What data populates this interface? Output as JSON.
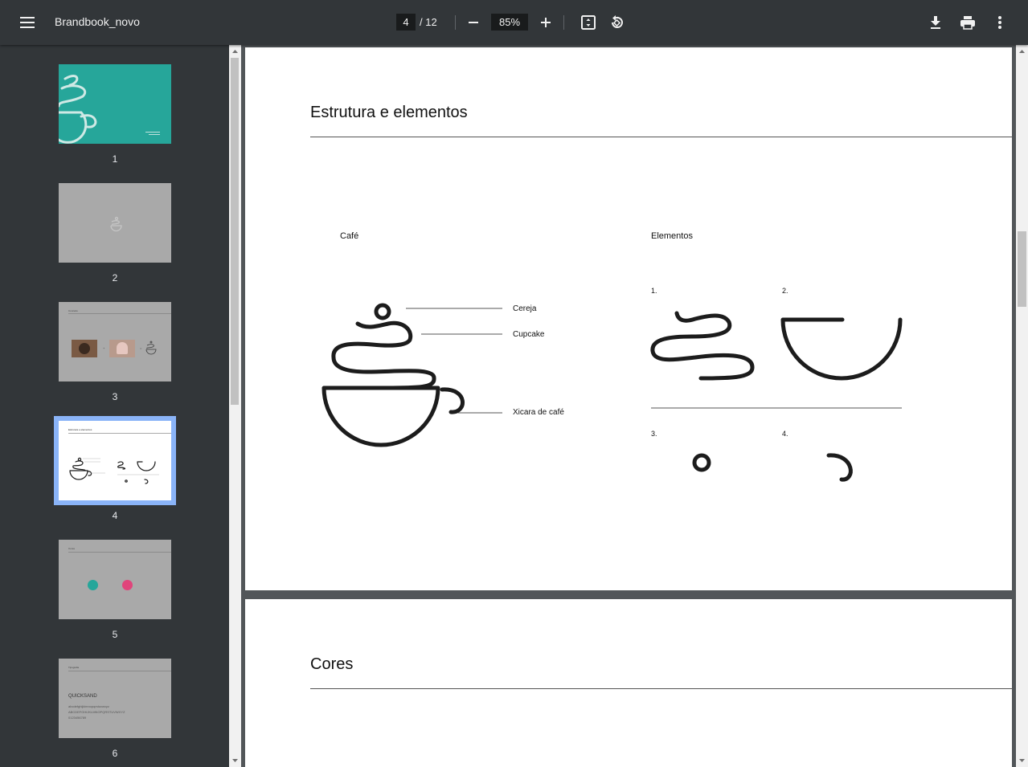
{
  "toolbar": {
    "title": "Brandbook_novo",
    "current_page": "4",
    "total_pages": "/ 12",
    "zoom": "85%"
  },
  "thumbnails": [
    {
      "number": "1"
    },
    {
      "number": "2"
    },
    {
      "number": "3"
    },
    {
      "number": "4"
    },
    {
      "number": "5"
    },
    {
      "number": "6"
    }
  ],
  "thumb_text": {
    "t3_title": "Conceito",
    "t4_title": "Estrutura e elementos",
    "t5_title": "Cores",
    "t6_title": "Tipografia",
    "t6_font": "QUICKSAND",
    "t6_lower": "abcdefghijklmnopqrstuvwxyz",
    "t6_upper": "ABCDEFGHIJKLMNOPQRSTUVWXYZ",
    "t6_digits": "0123456789"
  },
  "page4": {
    "heading": "Estrutura e elementos",
    "cafe_label": "Café",
    "elementos_label": "Elementos",
    "callouts": [
      "Cereja",
      "Cupcake",
      "Xicara de café"
    ],
    "element_numbers": [
      "1.",
      "2.",
      "3.",
      "4."
    ]
  },
  "page5": {
    "heading": "Cores"
  },
  "colors": {
    "teal": "#26a69a",
    "pink": "#e0457b",
    "selected_outline": "#8ab4f8"
  }
}
